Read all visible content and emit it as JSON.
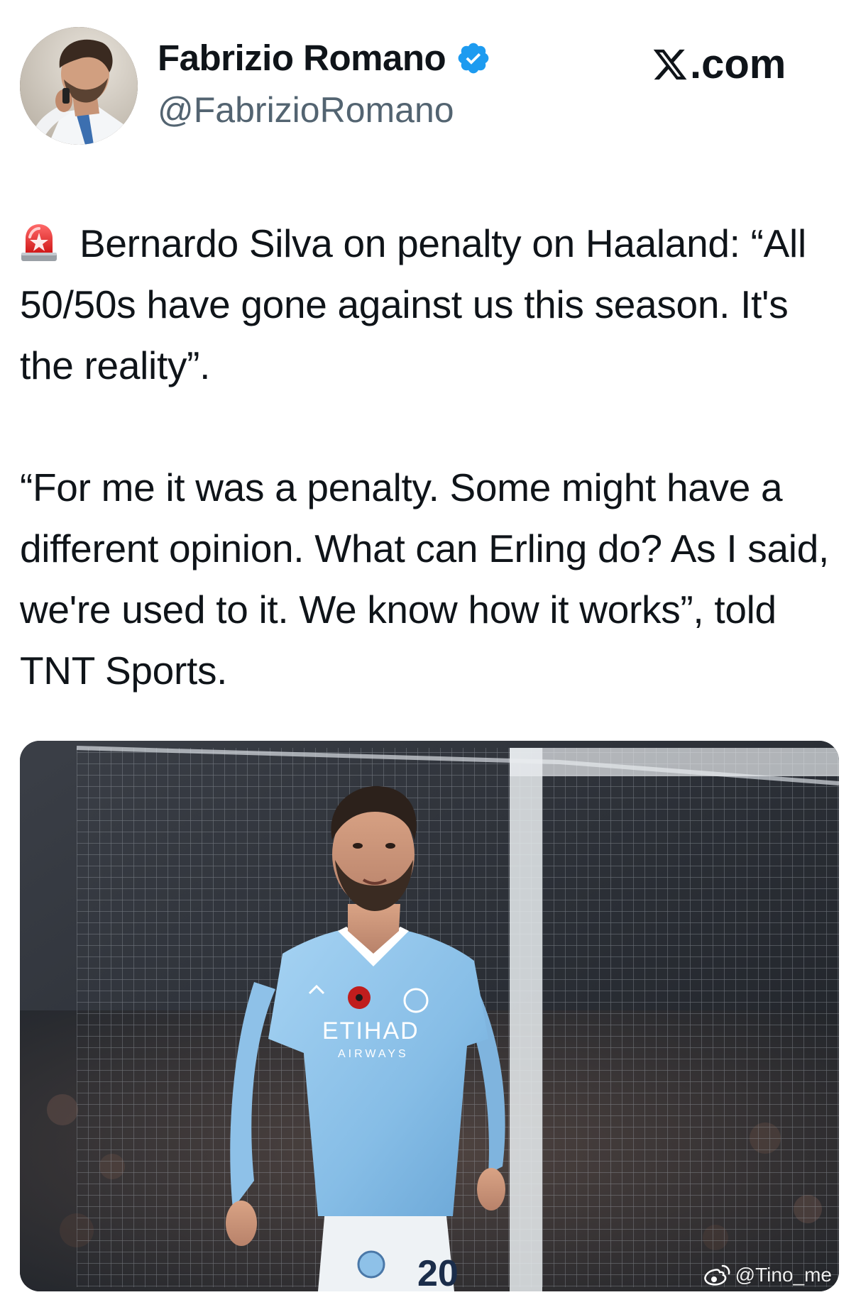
{
  "header": {
    "display_name": "Fabrizio Romano",
    "handle": "@FabrizioRomano",
    "site_label": ".com",
    "verified": true
  },
  "tweet": {
    "paragraphs": [
      "Bernardo Silva on penalty on Haaland: “All 50/50s have gone against us this season. It's the reality”.",
      "“For me it was a penalty. Some might have a different opinion. What can Erling do? As I said, we're used to it. We know how it works”, told TNT Sports."
    ]
  },
  "media": {
    "shirt_sponsor": "ETIHAD",
    "shirt_sponsor_sub": "AIRWAYS",
    "shirt_number": "20",
    "watermark": "@Tino_me"
  },
  "colors": {
    "verified_blue": "#1d9bf0",
    "text_primary": "#0f1419",
    "text_secondary": "#536471",
    "city_sky_blue": "#8ec1e8"
  },
  "icons": [
    "verified-badge-icon",
    "x-logo-icon",
    "siren-icon",
    "weibo-icon"
  ]
}
